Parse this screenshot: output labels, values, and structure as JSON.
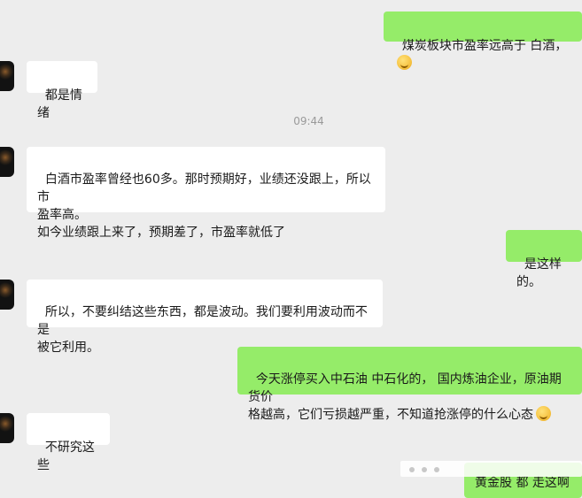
{
  "chat": {
    "messages": [
      {
        "side": "sent",
        "text": "煤炭板块市盈率远高于 白酒，",
        "emoji": "grinning-sweat-emoji"
      },
      {
        "side": "recv",
        "text": "都是情绪"
      },
      {
        "side": "recv",
        "text": "白酒市盈率曾经也60多。那时预期好，业绩还没跟上，所以市\n盈率高。\n如今业绩跟上来了，预期差了，市盈率就低了"
      },
      {
        "side": "sent",
        "text": "是这样的。"
      },
      {
        "side": "recv",
        "text": "所以，不要纠结这些东西，都是波动。我们要利用波动而不是\n被它利用。"
      },
      {
        "side": "sent",
        "text": "今天涨停买入中石油 中石化的， 国内炼油企业，原油期货价\n格越高，它们亏损越严重，不知道抢涨停的什么心态",
        "emoji": "thinking-emoji"
      },
      {
        "side": "recv",
        "text": "不研究这些"
      },
      {
        "side": "sent",
        "text": "黄金股 都 走这啊"
      }
    ],
    "timestamp": "09:44"
  },
  "colors": {
    "background": "#ededed",
    "sent_bubble": "#95ec69",
    "recv_bubble": "#ffffff"
  }
}
